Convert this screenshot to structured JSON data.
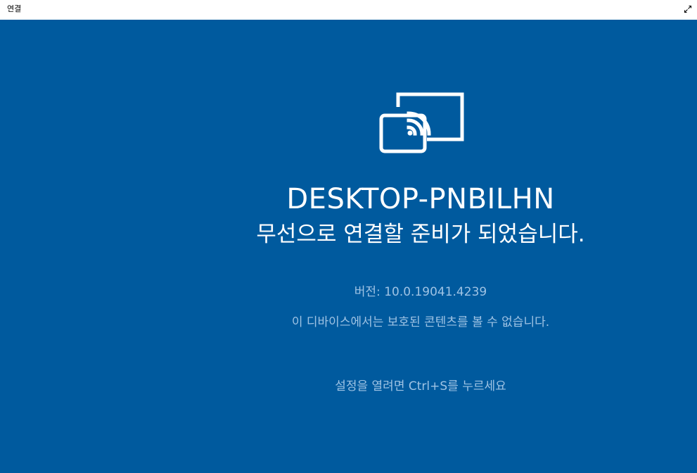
{
  "window": {
    "title": "연결",
    "fullscreen_icon": "expand-diagonal-icon"
  },
  "main": {
    "icon": "wireless-display-cast-icon",
    "device_name": "DESKTOP-PNBILHN",
    "ready_message": "무선으로 연결할 준비가 되었습니다.",
    "version": "버전: 10.0.19041.4239",
    "protected_content": "이 디바이스에서는 보호된 콘텐츠를 볼 수 없습니다.",
    "settings_hint": "설정을 열려면 Ctrl+S를 누르세요"
  },
  "colors": {
    "background": "#005a9e",
    "text_primary": "#ffffff",
    "text_secondary": "#9fc3e4",
    "titlebar": "#ffffff"
  }
}
